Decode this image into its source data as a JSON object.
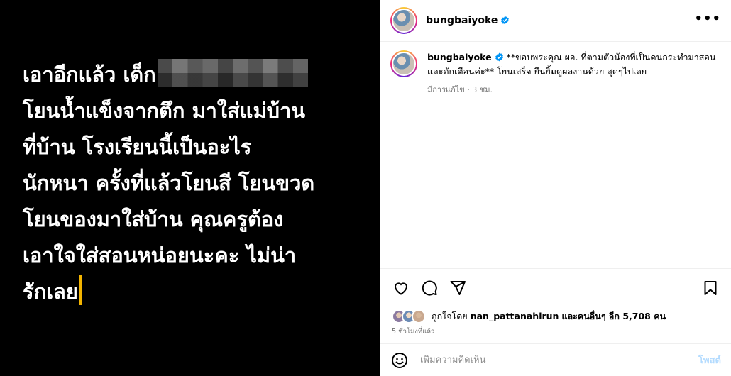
{
  "media": {
    "lines": [
      "เอาอีกแล้ว เด็ก",
      "โยนน้ำแข็งจากตึก มาใส่แม่บ้าน",
      "ที่บ้าน โรงเรียนนี้เป็นอะไร",
      "นักหนา ครั้งที่แล้วโยนสี โยนขวด",
      "โยนของมาใส่บ้าน คุณครูต้อง",
      "เอาใจใส่สอนหน่อยนะคะ ไม่น่า",
      "รักเลย"
    ],
    "accent_cursor_color": "#f3b400"
  },
  "header": {
    "username": "bungbaiyoke",
    "more_icon": "ellipsis-icon"
  },
  "caption": {
    "username": "bungbaiyoke",
    "text": "**ขอบพระคุณ ผอ. ที่ตามตัวน้องที่เป็นคนกระทำมาสอนและตักเตือนค่ะ** โยนเสร็จ ยืนยิ้มดูผลงานด้วย สุดๆไปเลย",
    "meta": "มีการแก้ไข · 3 ชม."
  },
  "actions": {
    "icons": [
      "heart-icon",
      "comment-icon",
      "share-icon",
      "bookmark-icon"
    ]
  },
  "likes": {
    "prefix": "ถูกใจโดย",
    "user": "nan_pattanahirun",
    "suffix": "และคนอื่นๆ อีก 5,708 คน",
    "time_ago": "5 ชั่วโมงที่แล้ว"
  },
  "comment": {
    "placeholder": "เพิ่มความคิดเห็น",
    "post_label": "โพสต์"
  },
  "colors": {
    "verified": "#0095f6",
    "post_button_disabled": "#b3dbff"
  }
}
